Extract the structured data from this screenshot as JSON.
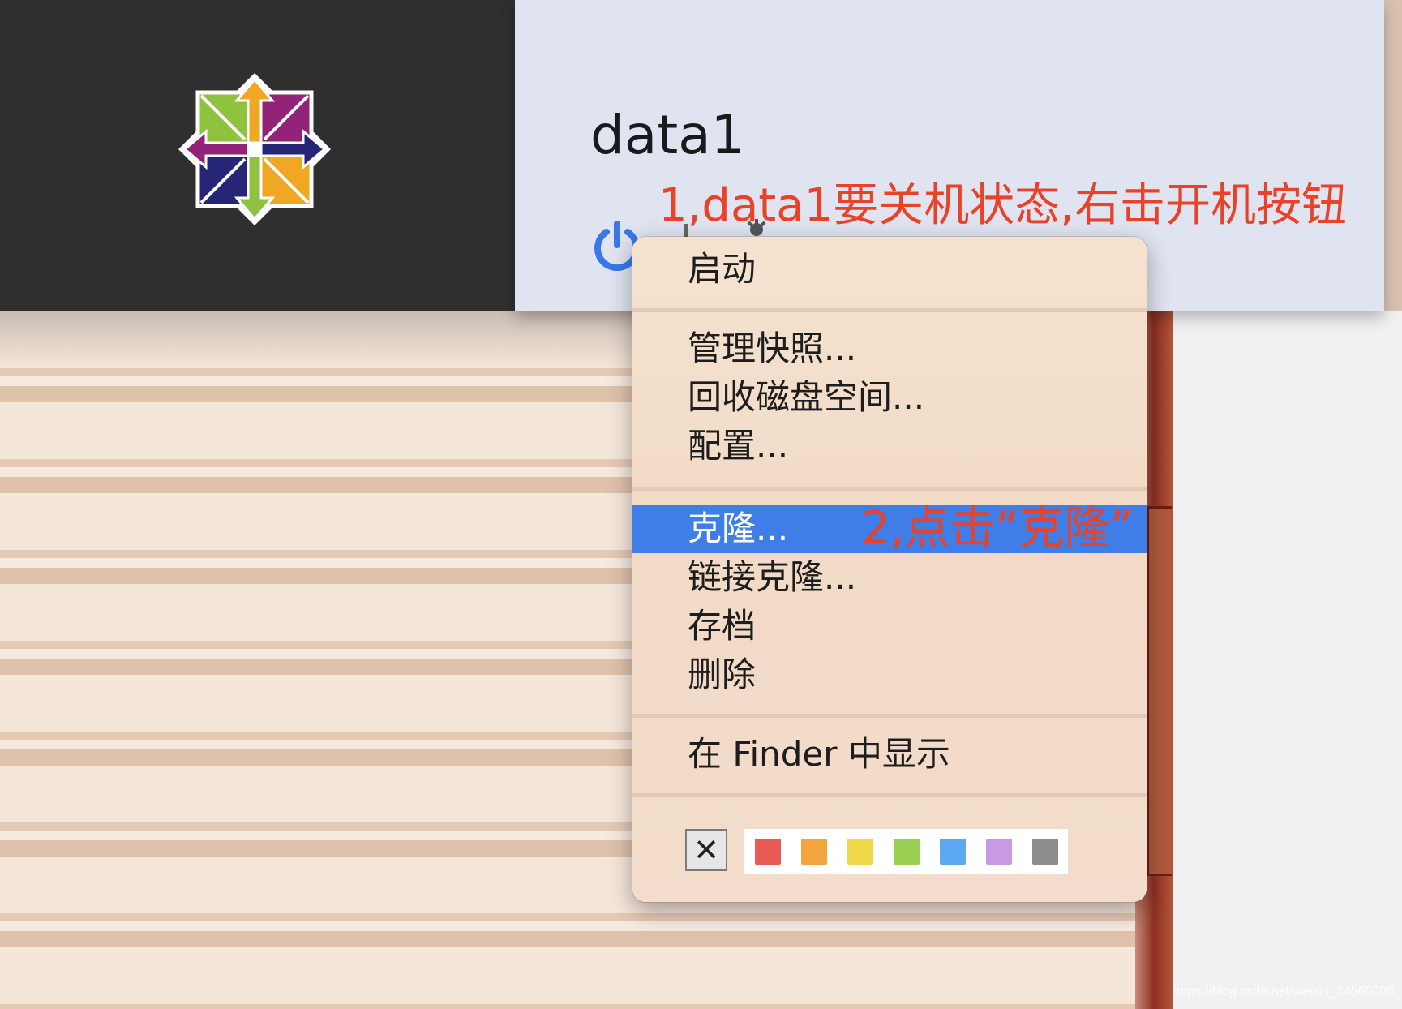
{
  "vm": {
    "name": "data1"
  },
  "annotations": {
    "step1": "1,data1要关机状态,右击开机按钮",
    "step2": "2,点击“克隆”"
  },
  "menu": {
    "start": "启动",
    "manage_snapshots": "管理快照...",
    "reclaim_disk": "回收磁盘空间...",
    "configure": "配置...",
    "clone": "克隆...",
    "linked_clone": "链接克隆...",
    "archive": "存档",
    "delete": "删除",
    "show_in_finder": "在 Finder 中显示",
    "clear_tag_symbol": "✕"
  },
  "tag_colors": [
    "#ea5b57",
    "#f2a53d",
    "#f0d84a",
    "#9ad052",
    "#5ca8f3",
    "#c79ae3",
    "#8c8c8c"
  ],
  "watermark": "https://blog.csdn.net/weixin_34566605"
}
